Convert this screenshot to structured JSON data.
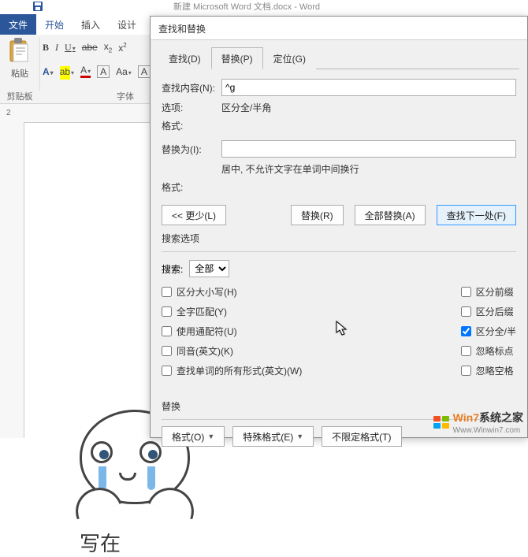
{
  "app": {
    "title_fragment": "新建 Microsoft Word 文档.docx - Word"
  },
  "ribbon": {
    "file": "文件",
    "tabs": [
      "开始",
      "插入",
      "设计"
    ],
    "paste_label": "粘贴",
    "clipboard_label": "剪贴板",
    "font_label": "字体",
    "ruler_num": "2"
  },
  "dialog": {
    "title": "查找和替换",
    "tabs": {
      "find": "查找(D)",
      "replace": "替换(P)",
      "goto": "定位(G)"
    },
    "find_label": "查找内容(N):",
    "find_value": "^g",
    "options_label": "选项:",
    "options_value": "区分全/半角",
    "format_label": "格式:",
    "replace_label": "替换为(I):",
    "replace_value": "",
    "replace_note": "居中, 不允许文字在单词中间换行",
    "buttons": {
      "less": "<< 更少(L)",
      "replace": "替换(R)",
      "replace_all": "全部替换(A)",
      "find_next": "查找下一处(F)"
    },
    "search_options_label": "搜索选项",
    "search_label": "搜索:",
    "search_value": "全部",
    "checks_left": [
      {
        "label": "区分大小写(H)",
        "checked": false
      },
      {
        "label": "全字匹配(Y)",
        "checked": false
      },
      {
        "label": "使用通配符(U)",
        "checked": false
      },
      {
        "label": "同音(英文)(K)",
        "checked": false
      },
      {
        "label": "查找单词的所有形式(英文)(W)",
        "checked": false
      }
    ],
    "checks_right": [
      {
        "label": "区分前缀",
        "checked": false
      },
      {
        "label": "区分后缀",
        "checked": false
      },
      {
        "label": "区分全/半",
        "checked": true
      },
      {
        "label": "忽略标点",
        "checked": false
      },
      {
        "label": "忽略空格",
        "checked": false
      }
    ],
    "replace_section": "替换",
    "bottom_buttons": {
      "format": "格式(O)",
      "special": "特殊格式(E)",
      "noformat": "不限定格式(T)"
    }
  },
  "doc": {
    "cartoon_text": "写在"
  },
  "watermark": {
    "brand": "Win7",
    "brand2": "系统之家",
    "url": "Www.Winwin7.com"
  }
}
